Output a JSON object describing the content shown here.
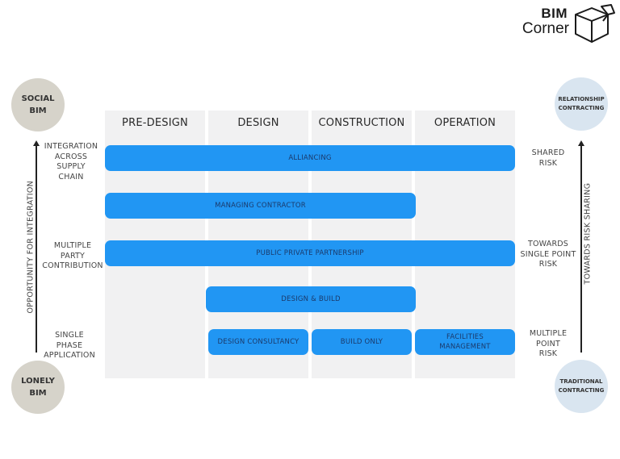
{
  "logo": {
    "line1": "BIM",
    "line2": "Corner",
    "icon": "open-box-icon"
  },
  "columns": [
    {
      "label": "PRE-DESIGN"
    },
    {
      "label": "DESIGN"
    },
    {
      "label": "CONSTRUCTION"
    },
    {
      "label": "OPERATION"
    }
  ],
  "bars": [
    {
      "label": "ALLIANCING",
      "phases": [
        "PRE-DESIGN",
        "DESIGN",
        "CONSTRUCTION",
        "OPERATION"
      ]
    },
    {
      "label": "MANAGING CONTRACTOR",
      "phases": [
        "PRE-DESIGN",
        "DESIGN",
        "CONSTRUCTION"
      ]
    },
    {
      "label": "PUBLIC PRIVATE PARTNERSHIP",
      "phases": [
        "PRE-DESIGN",
        "DESIGN",
        "CONSTRUCTION",
        "OPERATION"
      ]
    },
    {
      "label": "DESIGN & BUILD",
      "phases": [
        "DESIGN",
        "CONSTRUCTION"
      ]
    },
    {
      "label": "DESIGN CONSULTANCY",
      "phases": [
        "DESIGN"
      ]
    },
    {
      "label": "BUILD ONLY",
      "phases": [
        "CONSTRUCTION"
      ]
    },
    {
      "label_line1": "FACILITIES",
      "label_line2": "MANAGEMENT",
      "phases": [
        "OPERATION"
      ]
    }
  ],
  "left": {
    "top_circle": {
      "line1": "SOCIAL",
      "line2": "BIM"
    },
    "bottom_circle": {
      "line1": "LONELY",
      "line2": "BIM"
    },
    "axis_label": "OPPORTUNITY FOR INTEGRATION",
    "levels": [
      {
        "lines": [
          "INTEGRATION",
          "ACROSS",
          "SUPPLY",
          "CHAIN"
        ]
      },
      {
        "lines": [
          "MULTIPLE",
          "PARTY",
          "CONTRIBUTION"
        ]
      },
      {
        "lines": [
          "SINGLE",
          "PHASE",
          "APPLICATION"
        ]
      }
    ]
  },
  "right": {
    "top_circle": {
      "line1": "RELATIONSHIP",
      "line2": "CONTRACTING"
    },
    "bottom_circle": {
      "line1": "TRADITIONAL",
      "line2": "CONTRACTING"
    },
    "axis_label": "TOWARDS RISK SHARING",
    "levels": [
      {
        "lines": [
          "SHARED",
          "RISK"
        ]
      },
      {
        "lines": [
          "TOWARDS",
          "SINGLE POINT",
          "RISK"
        ]
      },
      {
        "lines": [
          "MULTIPLE",
          "POINT",
          "RISK"
        ]
      }
    ]
  },
  "colors": {
    "bar": "#2196f3",
    "bar_text": "#1b3a6b",
    "column_bg": "#f1f1f2",
    "bim_circle": "#d6d3ca",
    "contract_circle": "#d9e5f0"
  }
}
